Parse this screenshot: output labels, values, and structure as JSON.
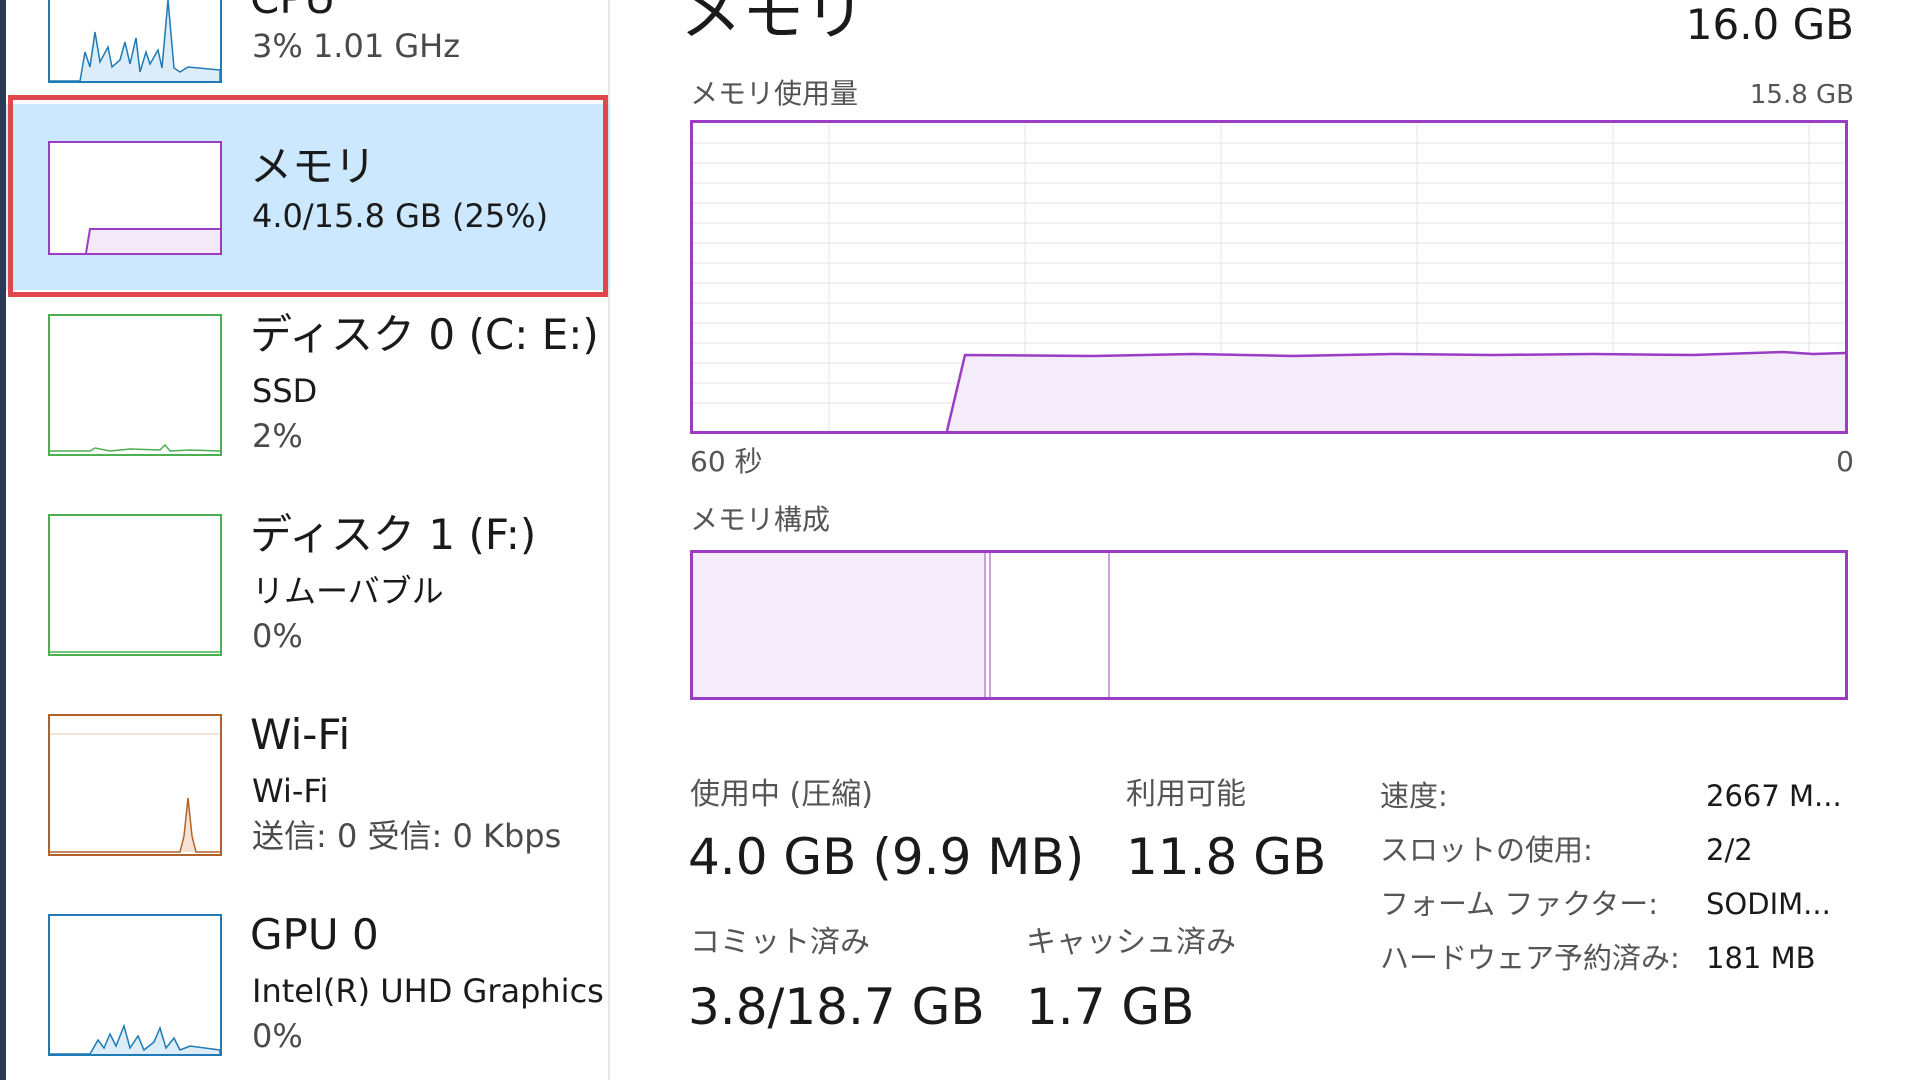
{
  "sidebar": {
    "items": [
      {
        "title": "CPU",
        "line1": "3%  1.01 GHz",
        "color": "#1f7ab5"
      },
      {
        "title": "メモリ",
        "line1": "4.0/15.8 GB (25%)",
        "color": "#9a3cc4"
      },
      {
        "title": "ディスク 0 (C: E:)",
        "line1": "SSD",
        "line2": "2%",
        "color": "#4caf50"
      },
      {
        "title": "ディスク 1 (F:)",
        "line1": "リムーバブル",
        "line2": "0%",
        "color": "#4caf50"
      },
      {
        "title": "Wi-Fi",
        "line1": "Wi-Fi",
        "line2": "送信: 0  受信: 0 Kbps",
        "color": "#b0622a"
      },
      {
        "title": "GPU 0",
        "line1": "Intel(R) UHD Graphics",
        "line2": "0%",
        "color": "#1f7ab5"
      }
    ]
  },
  "main": {
    "title": "メモリ",
    "total": "16.0 GB",
    "usage_label": "メモリ使用量",
    "usage_max": "15.8 GB",
    "time_left": "60 秒",
    "time_right": "0",
    "composition_label": "メモリ構成",
    "in_use_label": "使用中 (圧縮)",
    "in_use_value": "4.0 GB (9.9 MB)",
    "available_label": "利用可能",
    "available_value": "11.8 GB",
    "committed_label": "コミット済み",
    "committed_value": "3.8/18.7 GB",
    "cached_label": "キャッシュ済み",
    "cached_value": "1.7 GB",
    "specs": [
      {
        "label": "速度:",
        "value": "2667 M..."
      },
      {
        "label": "スロットの使用:",
        "value": "2/2"
      },
      {
        "label": "フォーム ファクター:",
        "value": "SODIM..."
      },
      {
        "label": "ハードウェア予約済み:",
        "value": "181 MB"
      }
    ]
  },
  "colors": {
    "accent": "#9a3cc4",
    "selected_bg": "#cce8ff",
    "highlight": "#e0474c"
  }
}
